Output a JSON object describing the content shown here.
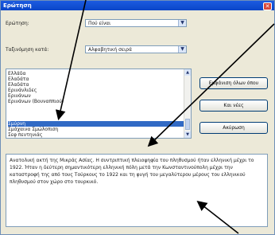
{
  "window": {
    "title": "Ερώτηση",
    "close_icon": "✕"
  },
  "question": {
    "label": "Ερώτηση:",
    "value": "Πού είναι"
  },
  "sort": {
    "label": "Ταξινόμηση κατά:",
    "value": "Αλφαβητική σειρά"
  },
  "list": {
    "items": [
      "Ελλάδα",
      "Ελαδάτα",
      "Ελαδάτα",
      "Ερινάνλιδες",
      "Ερινάνων",
      "Ερινάνων (Βουναππιού)",
      "Σμύρνη",
      "Σμάχαινα Σμώλοπιση",
      "Σεφ πεντηνιάς"
    ],
    "selected_index": 6
  },
  "buttons": {
    "show_all": "Εμφάνιση όλων όπου",
    "new": "Και νέες",
    "reset": "Ακύρωση"
  },
  "description": "Ανατολική ακτή της Μικράς Ασίας. Η συντριπτική πλειοψηφία του πληθυσμού ήταν ελληνική μέχρι το 1922. Ήταν η δεύτερη σημαντικότερη ελληνική πόλη μετά την Κωνσταντινούπολη μέχρι την καταστροφή της από τους Τούρκους το 1922 και τη φυγή του μεγαλύτερου μέρους του ελληνικού πληθυσμού στον χώρο στο τουρκικό.",
  "annotation": {
    "color": "#000000",
    "arrow_icon": "annotation-arrow"
  }
}
